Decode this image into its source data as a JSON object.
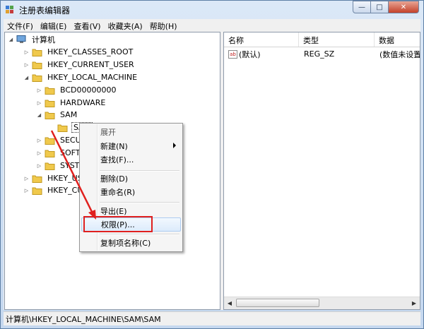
{
  "window": {
    "title": "注册表编辑器",
    "close_glyph": "✕",
    "max_glyph": "□",
    "min_glyph": "—"
  },
  "menubar": [
    "文件(F)",
    "编辑(E)",
    "查看(V)",
    "收藏夹(A)",
    "帮助(H)"
  ],
  "tree": {
    "root": "计算机",
    "items": [
      {
        "label": "HKEY_CLASSES_ROOT"
      },
      {
        "label": "HKEY_CURRENT_USER"
      },
      {
        "label": "HKEY_LOCAL_MACHINE"
      },
      {
        "label": "BCD00000000"
      },
      {
        "label": "HARDWARE"
      },
      {
        "label": "SAM"
      },
      {
        "label": "SAM"
      },
      {
        "label": "SECURITY"
      },
      {
        "label": "SOFTWARE"
      },
      {
        "label": "SYSTEM"
      },
      {
        "label": "HKEY_USERS"
      },
      {
        "label": "HKEY_CURRENT_CONFIG"
      }
    ]
  },
  "list": {
    "columns": [
      "名称",
      "类型",
      "数据"
    ],
    "rows": [
      {
        "name": "(默认)",
        "type": "REG_SZ",
        "data": "(数值未设置)"
      }
    ],
    "icon_text": "ab"
  },
  "context_menu": {
    "items": [
      "展开",
      "新建(N)",
      "查找(F)...",
      "删除(D)",
      "重命名(R)",
      "导出(E)",
      "权限(P)...",
      "复制项名称(C)"
    ]
  },
  "statusbar": {
    "path": "计算机\\HKEY_LOCAL_MACHINE\\SAM\\SAM"
  },
  "colors": {
    "annotation_red": "#e0201e",
    "folder_yellow": "#f0c94c"
  }
}
